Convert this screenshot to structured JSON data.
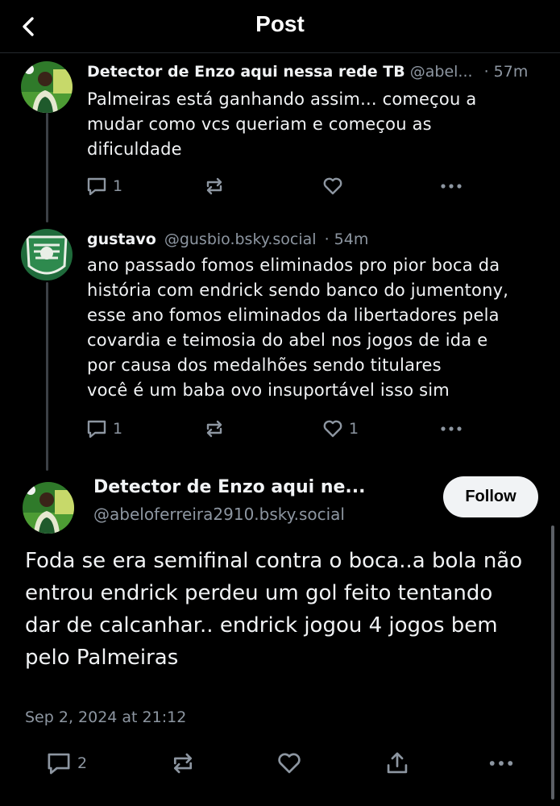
{
  "header": {
    "title": "Post",
    "back_icon": "chevron-left-icon"
  },
  "parent_posts": [
    {
      "author": "Detector de Enzo aqui nessa rede TB",
      "handle": "@abel...",
      "time": "· 57m",
      "text_lines": [
        "Palmeiras está ganhando assim... começou a",
        "mudar como vcs queriam e começou as",
        "dificuldade"
      ],
      "reply_count": "1",
      "like_count": ""
    },
    {
      "author": "gustavo",
      "handle": "@gusbio.bsky.social",
      "time": "· 54m",
      "text_lines": [
        "ano passado fomos eliminados pro pior boca da",
        "história com endrick sendo banco do jumentony,",
        "esse ano fomos eliminados da libertadores pela",
        "covardia e teimosia do abel nos jogos de ida e",
        "por causa dos medalhões sendo titulares",
        "você é um baba ovo insuportável isso sim"
      ],
      "reply_count": "1",
      "like_count": "1"
    }
  ],
  "main_post": {
    "author": "Detector de Enzo aqui ne...",
    "handle": "@abeloferreira2910.bsky.social",
    "follow_label": "Follow",
    "text_lines": [
      "Foda se era semifinal contra o boca..a bola não",
      "entrou endrick perdeu um gol feito tentando",
      "dar de calcanhar.. endrick jogou 4 jogos bem",
      "pelo Palmeiras"
    ],
    "date": "Sep 2, 2024 at 21:12",
    "reply_count": "2"
  },
  "colors": {
    "background": "#000000",
    "text": "#f1f3f5",
    "muted": "#8d96a1",
    "thread_line": "#3c4046"
  }
}
